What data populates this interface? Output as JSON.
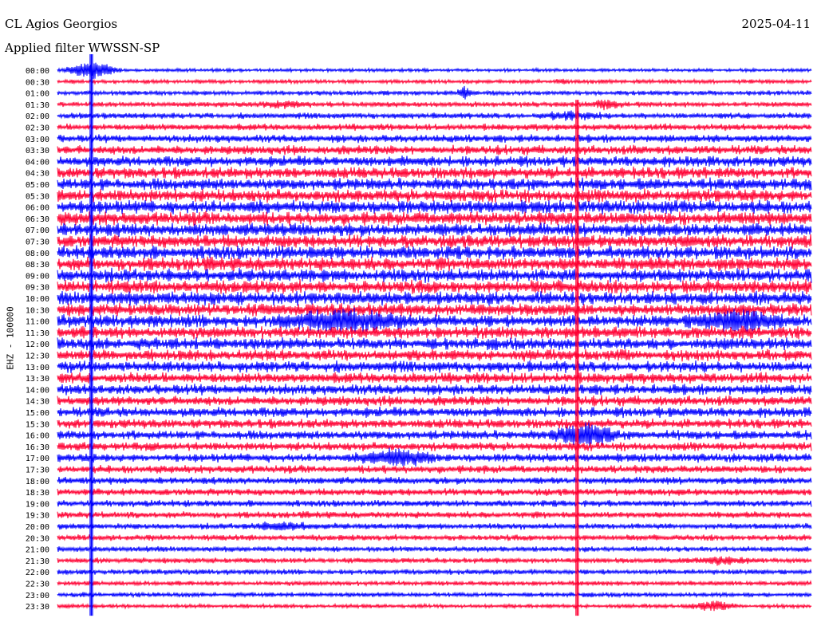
{
  "header": {
    "station": "CL Agios Georgios",
    "filter": "Applied filter WWSSN-SP",
    "date": "2025-04-11"
  },
  "chart_data": {
    "type": "line",
    "title": "CL Agios Georgios",
    "subtitle": "Applied filter WWSSN-SP",
    "date": "2025-04-11",
    "ylabel": "EHZ - 100000",
    "trace_colors": [
      "#0000ff",
      "#ff0033"
    ],
    "time_labels": [
      "00:00",
      "00:30",
      "01:00",
      "01:30",
      "02:00",
      "02:30",
      "03:00",
      "03:30",
      "04:00",
      "04:30",
      "05:00",
      "05:30",
      "06:00",
      "06:30",
      "07:00",
      "07:30",
      "08:00",
      "08:30",
      "09:00",
      "09:30",
      "10:00",
      "10:30",
      "11:00",
      "11:30",
      "12:00",
      "12:30",
      "13:00",
      "13:30",
      "14:00",
      "14:30",
      "15:00",
      "15:30",
      "16:00",
      "16:30",
      "17:00",
      "17:30",
      "18:00",
      "18:30",
      "19:00",
      "19:30",
      "20:00",
      "20:30",
      "21:00",
      "21:30",
      "22:00",
      "22:30",
      "23:00",
      "23:30"
    ],
    "noise_level": [
      0.25,
      0.3,
      0.35,
      0.4,
      0.45,
      0.5,
      0.6,
      0.7,
      0.8,
      0.85,
      0.9,
      0.95,
      1.0,
      1.0,
      1.0,
      1.0,
      1.0,
      1.0,
      1.0,
      1.0,
      1.0,
      0.95,
      0.95,
      0.9,
      0.9,
      0.85,
      0.85,
      0.8,
      0.8,
      0.75,
      0.75,
      0.7,
      0.7,
      0.65,
      0.65,
      0.6,
      0.55,
      0.55,
      0.5,
      0.5,
      0.45,
      0.45,
      0.4,
      0.4,
      0.4,
      0.35,
      0.35,
      0.3
    ],
    "events": [
      {
        "trace": 0,
        "time_fraction": 0.045,
        "amplitude": 7.0,
        "duration": 0.04
      },
      {
        "trace": 3,
        "time_fraction": 0.3,
        "amplitude": 1.2,
        "duration": 0.04
      },
      {
        "trace": 2,
        "time_fraction": 0.54,
        "amplitude": 3.5,
        "duration": 0.01
      },
      {
        "trace": 1,
        "time_fraction": 0.67,
        "amplitude": 1.0,
        "duration": 0.01
      },
      {
        "trace": 3,
        "time_fraction": 0.73,
        "amplitude": 2.5,
        "duration": 0.02
      },
      {
        "trace": 4,
        "time_fraction": 0.68,
        "amplitude": 1.3,
        "duration": 0.05
      },
      {
        "trace": 22,
        "time_fraction": 0.38,
        "amplitude": 1.6,
        "duration": 0.1
      },
      {
        "trace": 22,
        "time_fraction": 0.9,
        "amplitude": 1.5,
        "duration": 0.08
      },
      {
        "trace": 32,
        "time_fraction": 0.7,
        "amplitude": 3.0,
        "duration": 0.05
      },
      {
        "trace": 34,
        "time_fraction": 0.45,
        "amplitude": 2.0,
        "duration": 0.06
      },
      {
        "trace": 40,
        "time_fraction": 0.3,
        "amplitude": 1.2,
        "duration": 0.06
      },
      {
        "trace": 43,
        "time_fraction": 0.88,
        "amplitude": 1.4,
        "duration": 0.06
      },
      {
        "trace": 47,
        "time_fraction": 0.87,
        "amplitude": 2.5,
        "duration": 0.04
      }
    ],
    "vertical_spikes": [
      {
        "time_fraction": 0.045,
        "from_trace": 0,
        "to_trace": 47,
        "color": "#0000ff"
      },
      {
        "time_fraction": 0.69,
        "from_trace": 4,
        "to_trace": 47,
        "color": "#ff0033"
      }
    ]
  }
}
